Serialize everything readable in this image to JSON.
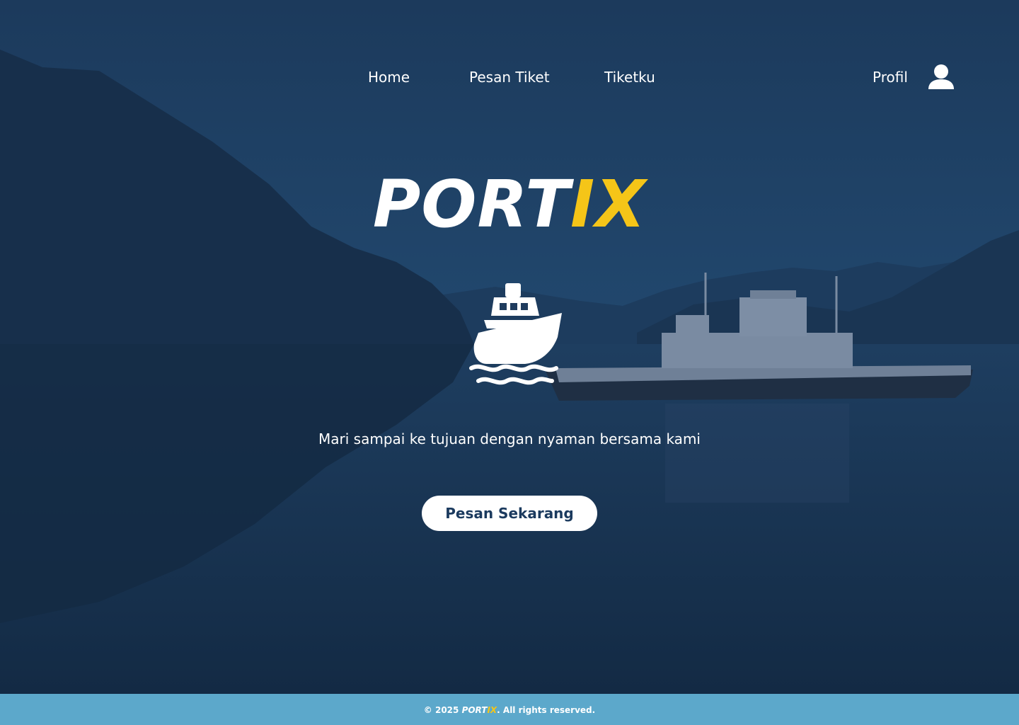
{
  "nav": {
    "home": "Home",
    "order_ticket": "Pesan Tiket",
    "my_tickets": "Tiketku",
    "profile": "Profil",
    "profile_icon": "user-icon"
  },
  "hero": {
    "brand_part1": "PORT",
    "brand_part2": "IX",
    "ship_icon": "ship-icon",
    "tagline": "Mari sampai ke tujuan dengan nyaman bersama kami",
    "cta_label": "Pesan Sekarang"
  },
  "footer": {
    "prefix": "© 2025 ",
    "brand_part1": "PORT",
    "brand_part2": "IX",
    "suffix": ". All rights reserved."
  },
  "colors": {
    "accent": "#f5c518",
    "overlay": "#1a3552",
    "footer_bg": "#5ca8cb",
    "button_text": "#1b3a5e"
  }
}
